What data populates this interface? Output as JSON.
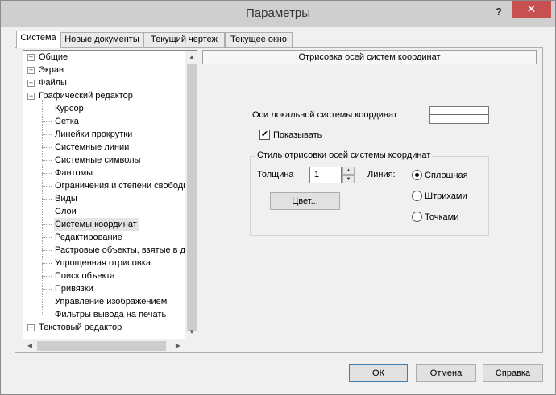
{
  "window": {
    "title": "Параметры",
    "help_glyph": "?",
    "close_glyph": "✕"
  },
  "tabs": [
    {
      "label": "Система",
      "active": true
    },
    {
      "label": "Новые документы",
      "active": false
    },
    {
      "label": "Текущий чертеж",
      "active": false
    },
    {
      "label": "Текущее окно",
      "active": false
    }
  ],
  "tree": {
    "items": [
      {
        "label": "Общие",
        "level": 0,
        "expander": "+"
      },
      {
        "label": "Экран",
        "level": 0,
        "expander": "+"
      },
      {
        "label": "Файлы",
        "level": 0,
        "expander": "+"
      },
      {
        "label": "Графический редактор",
        "level": 0,
        "expander": "−"
      },
      {
        "label": "Курсор",
        "level": 1
      },
      {
        "label": "Сетка",
        "level": 1
      },
      {
        "label": "Линейки прокрутки",
        "level": 1
      },
      {
        "label": "Системные линии",
        "level": 1
      },
      {
        "label": "Системные символы",
        "level": 1
      },
      {
        "label": "Фантомы",
        "level": 1
      },
      {
        "label": "Ограничения и степени свободы",
        "level": 1
      },
      {
        "label": "Виды",
        "level": 1
      },
      {
        "label": "Слои",
        "level": 1
      },
      {
        "label": "Системы координат",
        "level": 1,
        "selected": true
      },
      {
        "label": "Редактирование",
        "level": 1
      },
      {
        "label": "Растровые объекты, взятые в документ",
        "level": 1
      },
      {
        "label": "Упрощенная отрисовка",
        "level": 1
      },
      {
        "label": "Поиск объекта",
        "level": 1
      },
      {
        "label": "Привязки",
        "level": 1
      },
      {
        "label": "Управление изображением",
        "level": 1
      },
      {
        "label": "Фильтры вывода на печать",
        "level": 1
      },
      {
        "label": "Текстовый редактор",
        "level": 0,
        "expander": "+"
      }
    ]
  },
  "settings": {
    "header": "Отрисовка осей систем координат",
    "axes_label": "Оси локальной системы координат",
    "show_label": "Показывать",
    "show_checked": true,
    "check_glyph": "✔",
    "group_title": "Стиль отрисовки осей системы координат",
    "thickness_label": "Толщина",
    "thickness_value": "1",
    "line_label": "Линия:",
    "color_button": "Цвет...",
    "line_styles": [
      {
        "label": "Сплошная",
        "selected": true
      },
      {
        "label": "Штрихами",
        "selected": false
      },
      {
        "label": "Точками",
        "selected": false
      }
    ]
  },
  "footer": {
    "ok": "ОК",
    "cancel": "Отмена",
    "help": "Справка"
  }
}
